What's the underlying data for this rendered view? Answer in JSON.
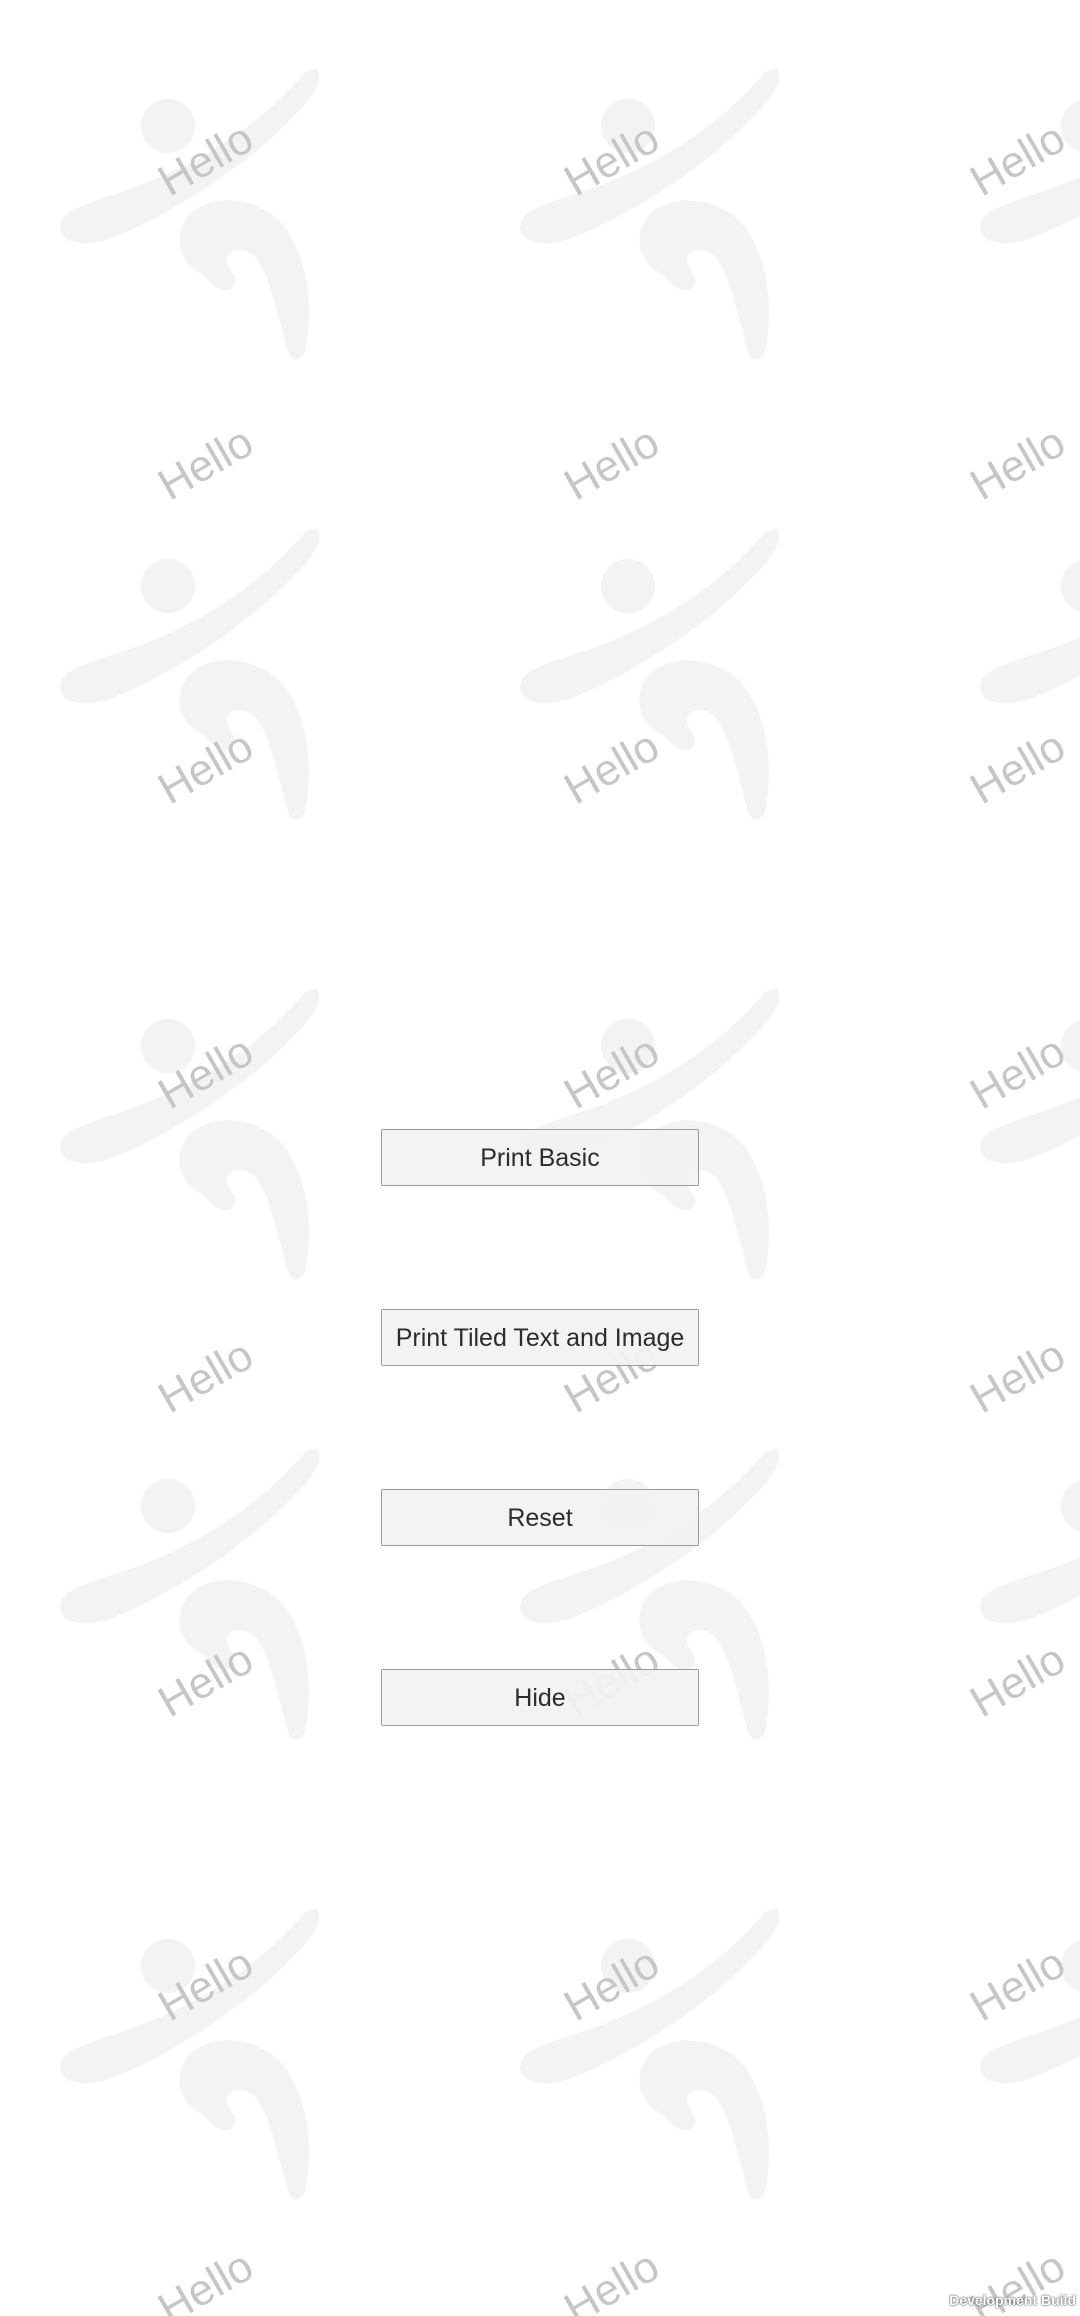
{
  "watermark": {
    "text": "Hello",
    "logo_icon": "stylized-figure-logo-icon",
    "text_color": "#c6c6c6",
    "logo_color": "#f3f3f3"
  },
  "buttons": {
    "print_basic": "Print Basic",
    "print_tiled": "Print Tiled Text and Image",
    "reset": "Reset",
    "hide": "Hide"
  },
  "footer": {
    "build_label": "Development Build"
  }
}
